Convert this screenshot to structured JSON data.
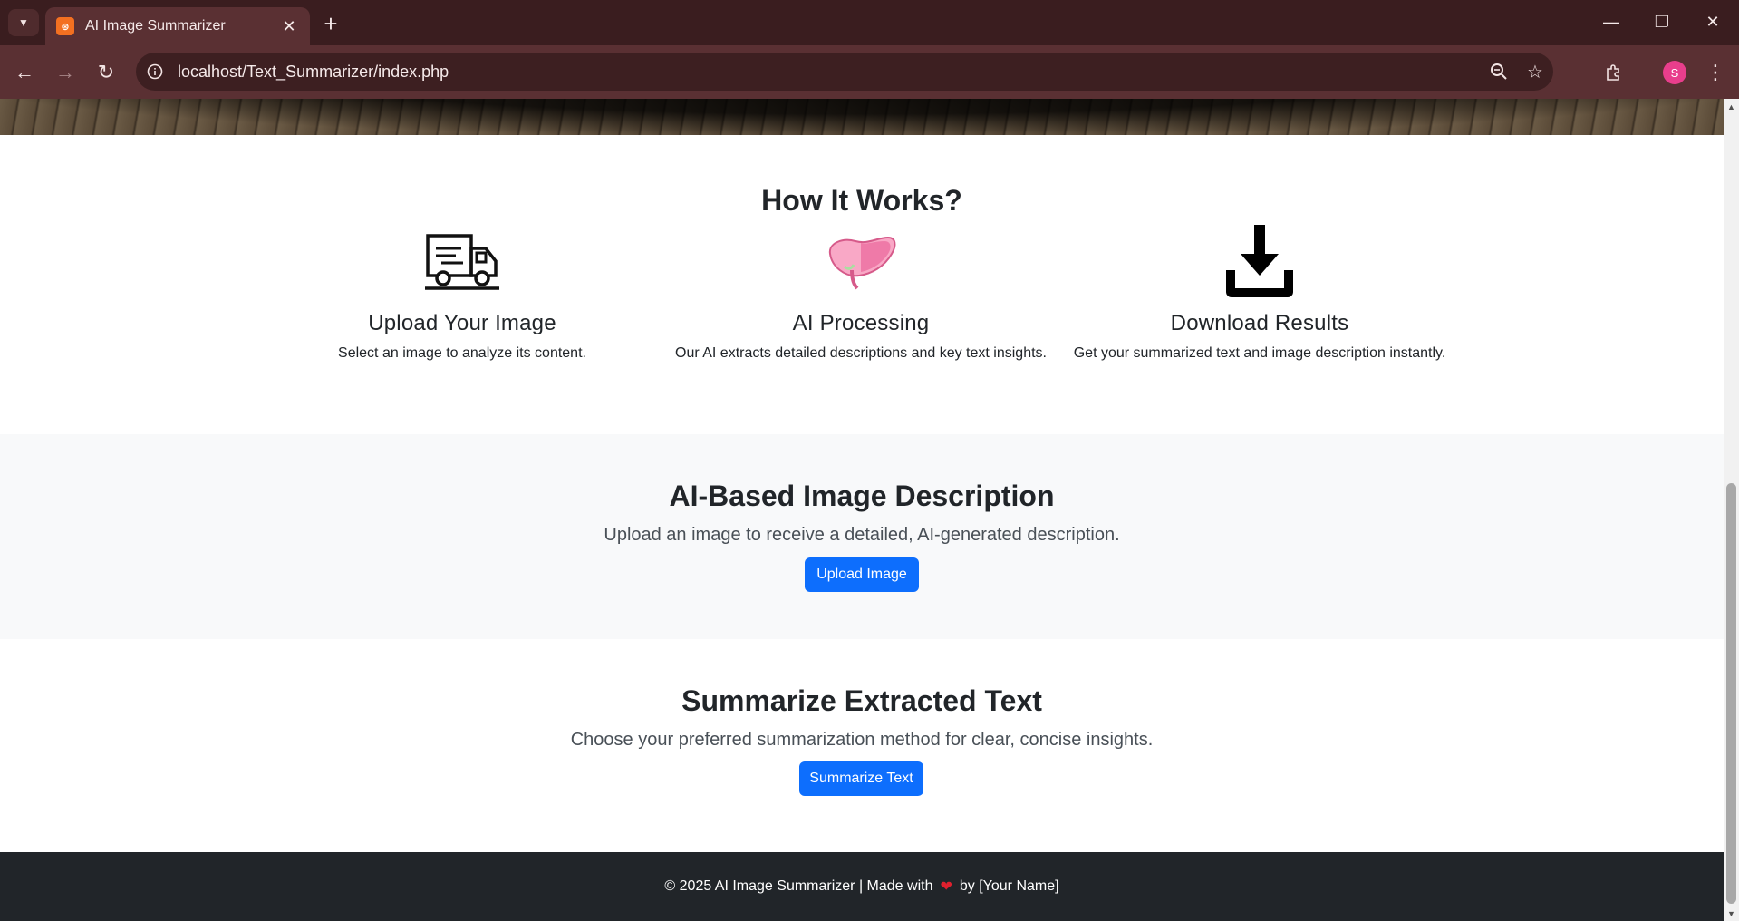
{
  "browser": {
    "tab_title": "AI Image Summarizer",
    "tab_favicon": "xampp-favicon",
    "url": "localhost/Text_Summarizer/index.php",
    "profile_initial": "S"
  },
  "how_it_works": {
    "heading": "How It Works?",
    "steps": [
      {
        "icon": "truck-icon",
        "title": "Upload Your Image",
        "desc": "Select an image to analyze its content."
      },
      {
        "icon": "liver-icon",
        "title": "AI Processing",
        "desc": "Our AI extracts detailed descriptions and key text insights."
      },
      {
        "icon": "download-icon",
        "title": "Download Results",
        "desc": "Get your summarized text and image description instantly."
      }
    ]
  },
  "image_description": {
    "heading": "AI-Based Image Description",
    "text": "Upload an image to receive a detailed, AI-generated description.",
    "button": "Upload Image"
  },
  "summarize": {
    "heading": "Summarize Extracted Text",
    "text": "Choose your preferred summarization method for clear, concise insights.",
    "button": "Summarize Text"
  },
  "footer": {
    "before": "© 2025 AI Image Summarizer | Made with",
    "after": "by [Your Name]",
    "heart_icon": "heart-icon"
  },
  "colors": {
    "primary_button": "#0d6efd",
    "footer_bg": "#212529",
    "section_alt_bg": "#f8f9fa",
    "browser_frame": "#3a1d1f"
  }
}
